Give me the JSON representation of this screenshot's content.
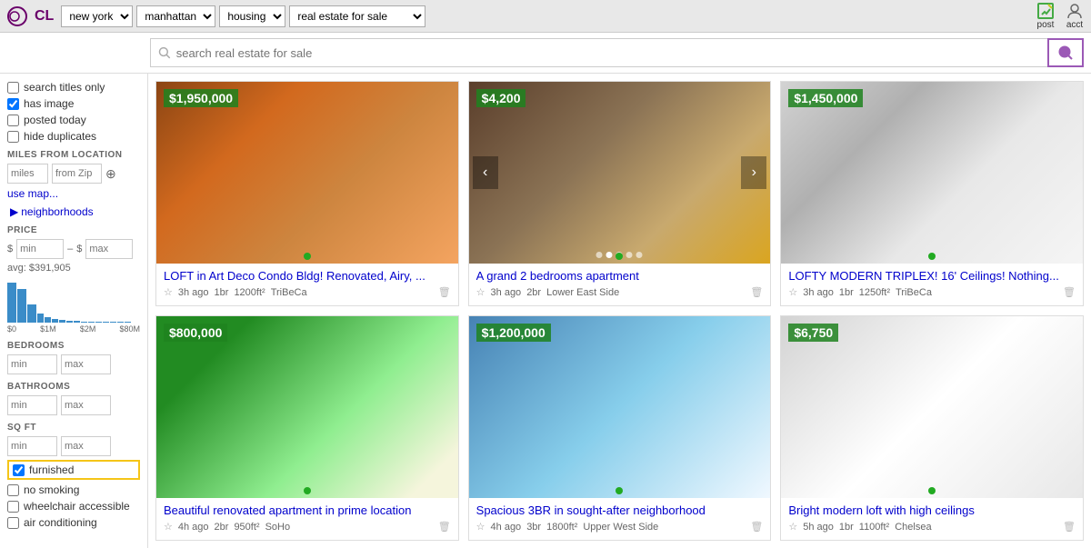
{
  "nav": {
    "logo_text": "CL",
    "city_options": [
      "new york"
    ],
    "city_selected": "new york",
    "area_options": [
      "manhattan"
    ],
    "area_selected": "manhattan",
    "category_options": [
      "housing"
    ],
    "category_selected": "housing",
    "subcategory_options": [
      "real estate for sale"
    ],
    "subcategory_selected": "real estate for sale",
    "post_label": "post",
    "acct_label": "acct"
  },
  "search": {
    "placeholder": "search real estate for sale"
  },
  "sidebar": {
    "search_titles_label": "search titles only",
    "has_image_label": "has image",
    "posted_today_label": "posted today",
    "hide_duplicates_label": "hide duplicates",
    "miles_section": "MILES FROM LOCATION",
    "miles_placeholder": "miles",
    "zip_placeholder": "from Zip",
    "use_map_label": "use map...",
    "neighborhoods_label": "neighborhoods",
    "price_section": "PRICE",
    "price_min_placeholder": "min",
    "price_max_placeholder": "max",
    "price_symbol": "$",
    "avg_text": "avg: $391,905",
    "hist_labels": [
      "$0",
      "$1M",
      "$2M",
      "",
      "$80M"
    ],
    "hist_bars": [
      45,
      38,
      20,
      10,
      6,
      4,
      3,
      2,
      2,
      1,
      1,
      1,
      1,
      1,
      1,
      1
    ],
    "bedrooms_section": "BEDROOMS",
    "bed_min_placeholder": "min",
    "bed_max_placeholder": "max",
    "bathrooms_section": "BATHROOMS",
    "bath_min_placeholder": "min",
    "bath_max_placeholder": "max",
    "sqft_section": "SQ FT",
    "sqft_min_placeholder": "min",
    "sqft_max_placeholder": "max",
    "furnished_label": "furnished",
    "no_smoking_label": "no smoking",
    "wheelchair_label": "wheelchair accessible",
    "air_label": "air conditioning"
  },
  "listings": [
    {
      "id": 1,
      "price": "$1,950,000",
      "title": "LOFT in Art Deco Condo Bldg! Renovated, Airy, ...",
      "time": "3h ago",
      "beds": "1br",
      "sqft": "1200ft²",
      "area": "TriBeCa",
      "has_dots": false,
      "img_class": "img-bg-1"
    },
    {
      "id": 2,
      "price": "$4,200",
      "title": "A grand 2 bedrooms apartment",
      "time": "3h ago",
      "beds": "2br",
      "sqft": "",
      "area": "Lower East Side",
      "has_dots": true,
      "img_class": "img-bg-2"
    },
    {
      "id": 3,
      "price": "$1,450,000",
      "title": "LOFTY MODERN TRIPLEX! 16' Ceilings! Nothing...",
      "time": "3h ago",
      "beds": "1br",
      "sqft": "1250ft²",
      "area": "TriBeCa",
      "has_dots": false,
      "img_class": "img-bg-3"
    },
    {
      "id": 4,
      "price": "$800,000",
      "title": "Beautiful renovated apartment in prime location",
      "time": "4h ago",
      "beds": "2br",
      "sqft": "950ft²",
      "area": "SoHo",
      "has_dots": false,
      "img_class": "img-bg-4"
    },
    {
      "id": 5,
      "price": "$1,200,000",
      "title": "Spacious 3BR in sought-after neighborhood",
      "time": "4h ago",
      "beds": "3br",
      "sqft": "1800ft²",
      "area": "Upper West Side",
      "has_dots": false,
      "img_class": "img-bg-5"
    },
    {
      "id": 6,
      "price": "$6,750",
      "title": "Bright modern loft with high ceilings",
      "time": "5h ago",
      "beds": "1br",
      "sqft": "1100ft²",
      "area": "Chelsea",
      "has_dots": false,
      "img_class": "img-bg-6"
    }
  ]
}
